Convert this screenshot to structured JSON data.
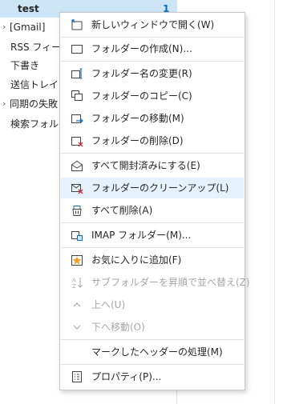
{
  "folders": [
    {
      "label": "test",
      "count": "1",
      "selected": true
    },
    {
      "label": "[Gmail]",
      "chevron": "›"
    },
    {
      "label": "RSS フィード"
    },
    {
      "label": "下書き"
    },
    {
      "label": "送信トレイ"
    },
    {
      "label": "同期の失敗",
      "chevron": "›"
    },
    {
      "label": "検索フォルダー"
    }
  ],
  "context_menu": {
    "items": [
      {
        "label": "新しいウィンドウで開く(W)",
        "icon": "new-window-icon"
      },
      {
        "label": "フォルダーの作成(N)...",
        "icon": "new-folder-icon"
      },
      {
        "label": "フォルダー名の変更(R)",
        "icon": "rename-folder-icon"
      },
      {
        "label": "フォルダーのコピー(C)",
        "icon": "copy-folder-icon"
      },
      {
        "label": "フォルダーの移動(M)",
        "icon": "move-folder-icon"
      },
      {
        "label": "フォルダーの削除(D)",
        "icon": "delete-folder-icon"
      },
      {
        "label": "すべて開封済みにする(E)",
        "icon": "mark-read-icon"
      },
      {
        "label": "フォルダーのクリーンアップ(L)",
        "icon": "cleanup-folder-icon",
        "highlighted": true
      },
      {
        "label": "すべて削除(A)",
        "icon": "delete-all-icon"
      },
      {
        "label": "IMAP フォルダー(M)...",
        "icon": "imap-folder-icon"
      },
      {
        "label": "お気に入りに追加(F)",
        "icon": "favorite-icon"
      },
      {
        "label": "サブフォルダーを昇順で並べ替え(Z)",
        "icon": "sort-az-icon",
        "disabled": true
      },
      {
        "label": "上へ(U)",
        "icon": "chevron-up-icon",
        "disabled": true
      },
      {
        "label": "下へ移動(O)",
        "icon": "chevron-down-icon",
        "disabled": true
      },
      {
        "label": "マークしたヘッダーの処理(M)",
        "icon": "none"
      },
      {
        "label": "プロパティ(P)...",
        "icon": "properties-icon"
      }
    ]
  },
  "colors": {
    "selection": "#cde6f7",
    "hover": "#e5f1fb",
    "accent": "#0f6cbd",
    "delete_red": "#d13438"
  }
}
